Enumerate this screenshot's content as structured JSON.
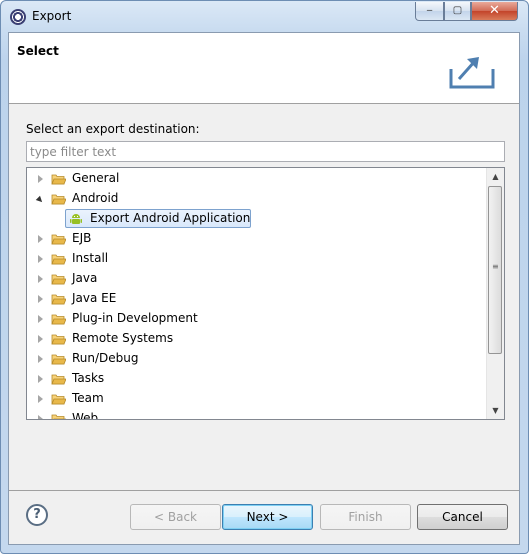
{
  "window": {
    "title": "Export",
    "controls": {
      "minimize": "‒",
      "maximize": "▢",
      "close": "✕"
    }
  },
  "header": {
    "title": "Select"
  },
  "prompt": "Select an export destination:",
  "filter": {
    "placeholder": "type filter text",
    "value": ""
  },
  "tree": {
    "items": [
      {
        "label": "General",
        "expanded": false
      },
      {
        "label": "Android",
        "expanded": true
      },
      {
        "label": "Export Android Application",
        "child": true,
        "selected": true
      },
      {
        "label": "EJB",
        "expanded": false
      },
      {
        "label": "Install",
        "expanded": false
      },
      {
        "label": "Java",
        "expanded": false
      },
      {
        "label": "Java EE",
        "expanded": false
      },
      {
        "label": "Plug-in Development",
        "expanded": false
      },
      {
        "label": "Remote Systems",
        "expanded": false
      },
      {
        "label": "Run/Debug",
        "expanded": false
      },
      {
        "label": "Tasks",
        "expanded": false
      },
      {
        "label": "Team",
        "expanded": false
      },
      {
        "label": "Web",
        "expanded": false
      }
    ]
  },
  "buttons": {
    "help": "?",
    "back": "< Back",
    "next": "Next >",
    "finish": "Finish",
    "cancel": "Cancel"
  },
  "colors": {
    "selection": "#d9e8fb",
    "android_green": "#97c024",
    "folder": "#e8b84a"
  }
}
